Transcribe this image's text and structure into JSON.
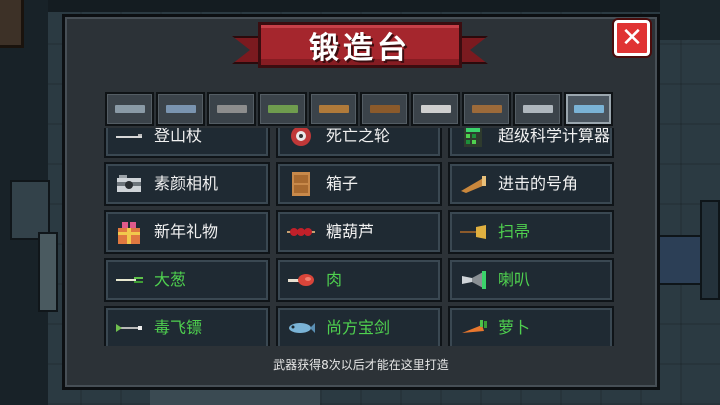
{
  "title": "锻造台",
  "close_symbol": "✕",
  "tabs": [
    {
      "icon": "pistol-icon",
      "color": "#8a9aa6"
    },
    {
      "icon": "rifle-icon",
      "color": "#7a94b0"
    },
    {
      "icon": "sniper-icon",
      "color": "#8d8d8d"
    },
    {
      "icon": "launcher-icon",
      "color": "#6f9c4e"
    },
    {
      "icon": "shotgun-icon",
      "color": "#b07a3a"
    },
    {
      "icon": "bow-icon",
      "color": "#8b5a2b"
    },
    {
      "icon": "sword-icon",
      "color": "#cfcfcf"
    },
    {
      "icon": "staff-icon",
      "color": "#9c6a3a"
    },
    {
      "icon": "throwing-star-icon",
      "color": "#aeb6bd"
    },
    {
      "icon": "fish-icon",
      "color": "#7ab3d6"
    }
  ],
  "items": [
    {
      "label": "登山杖",
      "color": "white",
      "icon": "hiking-stick-icon"
    },
    {
      "label": "死亡之轮",
      "color": "white",
      "icon": "death-wheel-icon"
    },
    {
      "label": "超级科学计算器",
      "color": "white",
      "icon": "calculator-icon"
    },
    {
      "label": "素颜相机",
      "color": "white",
      "icon": "camera-icon"
    },
    {
      "label": "箱子",
      "color": "white",
      "icon": "box-icon"
    },
    {
      "label": "进击的号角",
      "color": "white",
      "icon": "horn-icon"
    },
    {
      "label": "新年礼物",
      "color": "white",
      "icon": "gift-icon"
    },
    {
      "label": "糖葫芦",
      "color": "white",
      "icon": "candied-haws-icon"
    },
    {
      "label": "扫帚",
      "color": "green",
      "icon": "broom-icon"
    },
    {
      "label": "大葱",
      "color": "green",
      "icon": "scallion-icon"
    },
    {
      "label": "肉",
      "color": "green",
      "icon": "meat-icon"
    },
    {
      "label": "喇叭",
      "color": "green",
      "icon": "trumpet-icon"
    },
    {
      "label": "毒飞镖",
      "color": "green",
      "icon": "poison-dart-icon"
    },
    {
      "label": "尚方宝剑",
      "color": "green",
      "icon": "fish-sword-icon"
    },
    {
      "label": "萝卜",
      "color": "green",
      "icon": "carrot-icon"
    }
  ],
  "footer": "武器获得8次以后才能在这里打造"
}
